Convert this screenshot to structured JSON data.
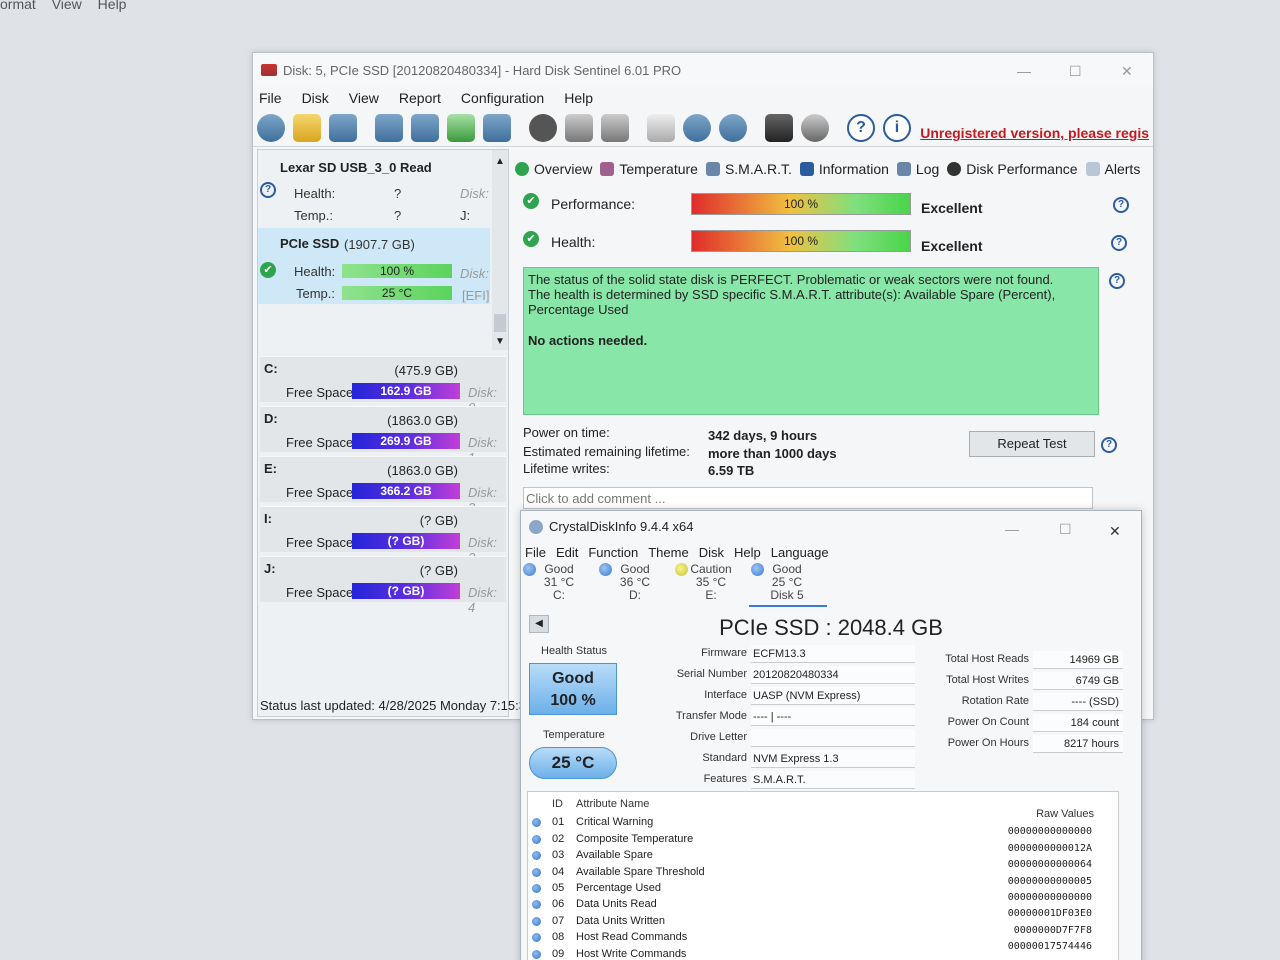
{
  "background_menu": [
    "ormat",
    "View",
    "Help"
  ],
  "hds": {
    "title": "Disk: 5, PCIe SSD [20120820480334]  -  Hard Disk Sentinel 6.01 PRO",
    "menu": [
      "File",
      "Disk",
      "View",
      "Report",
      "Configuration",
      "Help"
    ],
    "unregistered": "Unregistered version, please regis",
    "disks": [
      {
        "name": "Lexar   SD   USB_3_0 Read",
        "health_label": "Health:",
        "health": "?",
        "temp_label": "Temp.:",
        "temp": "?",
        "disk_label": "Disk:",
        "drive": "J:"
      },
      {
        "name": "PCIe SSD",
        "size": "(1907.7 GB)",
        "health_label": "Health:",
        "health": "100 %",
        "health_level": 1.0,
        "temp_label": "Temp.:",
        "temp": "25 °C",
        "disk_label": "Disk:",
        "drive": "[EFI]"
      }
    ],
    "volumes": [
      {
        "letter": "C:",
        "size": "(475.9 GB)",
        "free_label": "Free Space",
        "free": "162.9 GB",
        "disk": "Disk: 0"
      },
      {
        "letter": "D:",
        "size": "(1863.0 GB)",
        "free_label": "Free Space",
        "free": "269.9 GB",
        "disk": "Disk: 1"
      },
      {
        "letter": "E:",
        "size": "(1863.0 GB)",
        "free_label": "Free Space",
        "free": "366.2 GB",
        "disk": "Disk: 2"
      },
      {
        "letter": "I:",
        "size": "(? GB)",
        "free_label": "Free Space",
        "free": "(? GB)",
        "disk": "Disk: 3"
      },
      {
        "letter": "J:",
        "size": "(? GB)",
        "free_label": "Free Space",
        "free": "(? GB)",
        "disk": "Disk: 4"
      }
    ],
    "status_updated": "Status last updated: 4/28/2025 Monday 7:15:3",
    "tabs": [
      "Overview",
      "Temperature",
      "S.M.A.R.T.",
      "Information",
      "Log",
      "Disk Performance",
      "Alerts"
    ],
    "performance": {
      "label": "Performance:",
      "value": "100 %",
      "level": 1.0,
      "rating": "Excellent"
    },
    "health": {
      "label": "Health:",
      "value": "100 %",
      "level": 1.0,
      "rating": "Excellent"
    },
    "status_text": [
      "The status of the solid state disk is PERFECT. Problematic or weak sectors were not found.",
      "The health is determined by SSD specific S.M.A.R.T. attribute(s):  Available Spare (Percent),",
      "Percentage Used"
    ],
    "no_actions": "No actions needed.",
    "info": [
      {
        "label": "Power on time:",
        "value": "342 days, 9 hours"
      },
      {
        "label": "Estimated remaining lifetime:",
        "value": "more than 1000 days"
      },
      {
        "label": "Lifetime writes:",
        "value": "6.59 TB"
      }
    ],
    "repeat_test": "Repeat Test",
    "comment_placeholder": "Click to add comment ..."
  },
  "cdi": {
    "title": "CrystalDiskInfo 9.4.4 x64",
    "menu": [
      "File",
      "Edit",
      "Function",
      "Theme",
      "Disk",
      "Help",
      "Language"
    ],
    "disks": [
      {
        "status": "Good",
        "temp": "31 °C",
        "drive": "C:"
      },
      {
        "status": "Good",
        "temp": "36 °C",
        "drive": "D:"
      },
      {
        "status": "Caution",
        "temp": "35 °C",
        "drive": "E:"
      },
      {
        "status": "Good",
        "temp": "25 °C",
        "drive": "Disk 5"
      }
    ],
    "header": "PCIe SSD : 2048.4 GB",
    "health_status_label": "Health Status",
    "health_status": "Good",
    "health_percent": "100 %",
    "temperature_label": "Temperature",
    "temperature": "25 °C",
    "fields": [
      {
        "key": "Firmware",
        "value": "ECFM13.3"
      },
      {
        "key": "Serial Number",
        "value": "20120820480334"
      },
      {
        "key": "Interface",
        "value": "UASP (NVM Express)"
      },
      {
        "key": "Transfer Mode",
        "value": "---- | ----"
      },
      {
        "key": "Drive Letter",
        "value": ""
      },
      {
        "key": "Standard",
        "value": "NVM Express 1.3"
      },
      {
        "key": "Features",
        "value": "S.M.A.R.T."
      }
    ],
    "right_fields": [
      {
        "key": "Total Host Reads",
        "value": "14969 GB"
      },
      {
        "key": "Total Host Writes",
        "value": "6749 GB"
      },
      {
        "key": "Rotation Rate",
        "value": "---- (SSD)"
      },
      {
        "key": "Power On Count",
        "value": "184 count"
      },
      {
        "key": "Power On Hours",
        "value": "8217 hours"
      }
    ],
    "smart_headers": {
      "id": "ID",
      "name": "Attribute Name",
      "raw": "Raw Values"
    },
    "smart_rows": [
      {
        "id": "01",
        "name": "Critical Warning",
        "raw": "00000000000000"
      },
      {
        "id": "02",
        "name": "Composite Temperature",
        "raw": "0000000000012A"
      },
      {
        "id": "03",
        "name": "Available Spare",
        "raw": "00000000000064"
      },
      {
        "id": "04",
        "name": "Available Spare Threshold",
        "raw": "00000000000005"
      },
      {
        "id": "05",
        "name": "Percentage Used",
        "raw": "00000000000000"
      },
      {
        "id": "06",
        "name": "Data Units Read",
        "raw": "00000001DF03E0"
      },
      {
        "id": "07",
        "name": "Data Units Written",
        "raw": "0000000D7F7F8"
      },
      {
        "id": "08",
        "name": "Host Read Commands",
        "raw": "00000017574446"
      },
      {
        "id": "09",
        "name": "Host Write Commands",
        "raw": ""
      }
    ]
  }
}
